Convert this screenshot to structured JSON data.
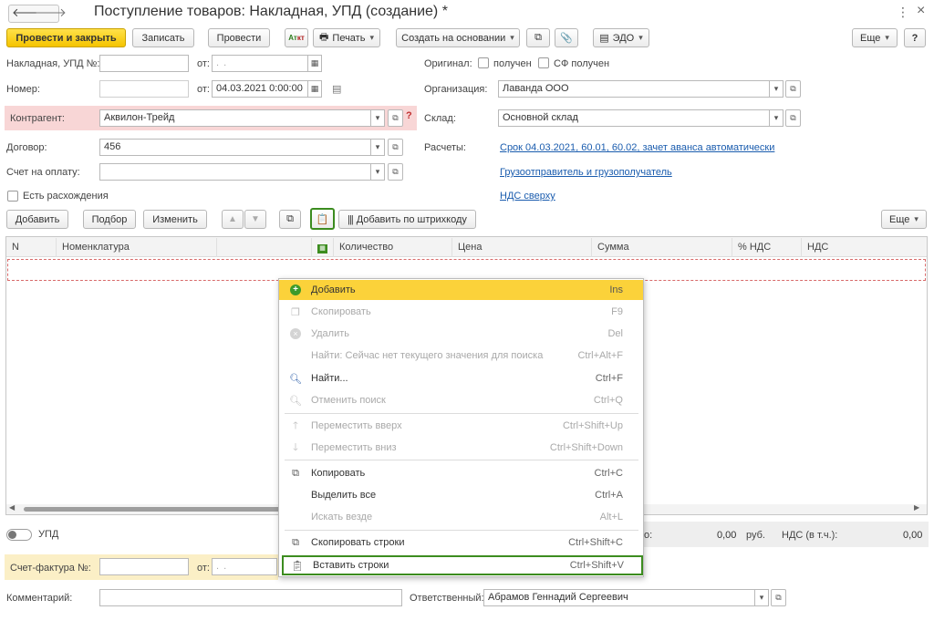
{
  "header": {
    "title": "Поступление товаров: Накладная, УПД (создание) *",
    "nav_back": "🡐",
    "nav_fwd": "🡒",
    "menu_dots": "⋮",
    "close": "×"
  },
  "toolbar": {
    "post_close": "Провести и закрыть",
    "save": "Записать",
    "post": "Провести",
    "print": "Печать",
    "create_based": "Создать на основании",
    "edo": "ЭДО",
    "more": "Еще",
    "help": "?"
  },
  "form": {
    "invoice_no_label": "Накладная, УПД №:",
    "from_label": "от:",
    "date_placeholder": ". .",
    "number_label": "Номер:",
    "number_date": "04.03.2021  0:00:00",
    "original_label": "Оригинал:",
    "received_label": "получен",
    "sf_received_label": "СФ получен",
    "org_label": "Организация:",
    "org_value": "Лаванда ООО",
    "counterparty_label": "Контрагент:",
    "counterparty_value": "Аквилон-Трейд",
    "help_mark": "?",
    "warehouse_label": "Склад:",
    "warehouse_value": "Основной склад",
    "contract_label": "Договор:",
    "contract_value": "456",
    "settlements_label": "Расчеты:",
    "settlements_link": "Срок 04.03.2021, 60.01, 60.02, зачет аванса автоматически",
    "pay_invoice_label": "Счет на оплату:",
    "shipper_link": "Грузоотправитель и грузополучатель",
    "discrepancy_label": "Есть расхождения",
    "vat_link": "НДС сверху"
  },
  "table_toolbar": {
    "add": "Добавить",
    "select": "Подбор",
    "change": "Изменить",
    "barcode": "Добавить по штрихкоду",
    "more": "Еще"
  },
  "table": {
    "columns": [
      "N",
      "Номенклатура",
      "",
      "Количество",
      "Цена",
      "Сумма",
      "% НДС",
      "НДС"
    ]
  },
  "context_menu": {
    "items": [
      {
        "label": "Добавить",
        "shortcut": "Ins"
      },
      {
        "label": "Скопировать",
        "shortcut": "F9"
      },
      {
        "label": "Удалить",
        "shortcut": "Del"
      },
      {
        "label": "Найти: Сейчас нет текущего значения для поиска",
        "shortcut": "Ctrl+Alt+F"
      },
      {
        "label": "Найти...",
        "shortcut": "Ctrl+F"
      },
      {
        "label": "Отменить поиск",
        "shortcut": "Ctrl+Q"
      },
      {
        "label": "Переместить вверх",
        "shortcut": "Ctrl+Shift+Up"
      },
      {
        "label": "Переместить вниз",
        "shortcut": "Ctrl+Shift+Down"
      },
      {
        "label": "Копировать",
        "shortcut": "Ctrl+C"
      },
      {
        "label": "Выделить все",
        "shortcut": "Ctrl+A"
      },
      {
        "label": "Искать везде",
        "shortcut": "Alt+L"
      },
      {
        "label": "Скопировать строки",
        "shortcut": "Ctrl+Shift+C"
      },
      {
        "label": "Вставить строки",
        "shortcut": "Ctrl+Shift+V"
      }
    ]
  },
  "footer": {
    "upd_label": "УПД",
    "total_partial": "о:",
    "total_value": "0,00",
    "currency": "руб.",
    "vat_included_label": "НДС (в т.ч.):",
    "vat_value": "0,00",
    "sf_label": "Счет-фактура №:",
    "sf_from": "от:",
    "comment_label": "Комментарий:",
    "responsible_label": "Ответственный:",
    "responsible_value": "Абрамов Геннадий Сергеевич"
  },
  "colors": {
    "accent_yellow": "#f5c400",
    "highlight_green": "#3c8c1f",
    "link": "#1a5cae",
    "counterparty_bg": "#f8d6d6"
  }
}
